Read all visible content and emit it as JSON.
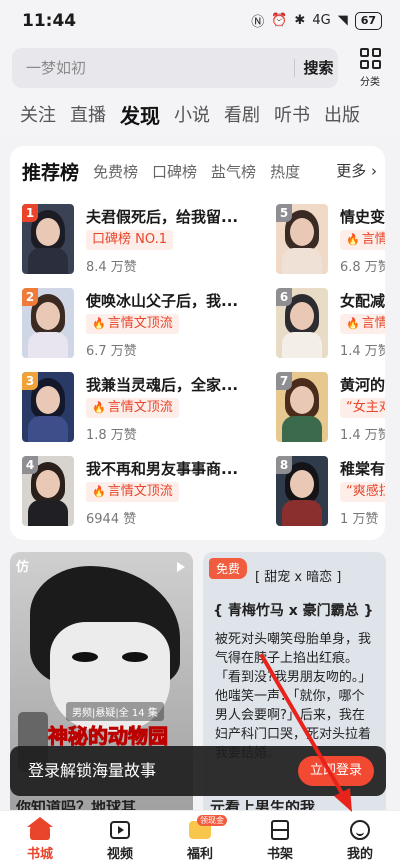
{
  "status": {
    "time": "11:44",
    "battery": "67",
    "signal": "4G"
  },
  "search": {
    "placeholder": "一梦如初",
    "button": "搜索",
    "category_label": "分类"
  },
  "tabs": [
    "关注",
    "直播",
    "发现",
    "小说",
    "看剧",
    "听书",
    "出版"
  ],
  "active_tab": "发现",
  "ranking": {
    "title": "推荐榜",
    "tabs": [
      "免费榜",
      "口碑榜",
      "盐气榜",
      "热度"
    ],
    "more": "更多",
    "books": [
      {
        "rank": "1",
        "title": "夫君假死后，给我留...",
        "tag": "口碑榜 NO.1",
        "likes": "8.4 万赞"
      },
      {
        "rank": "2",
        "title": "使唤冰山父子后，我...",
        "tag": "言情文顶流",
        "likes": "6.7 万赞"
      },
      {
        "rank": "3",
        "title": "我兼当灵魂后，全家...",
        "tag": "言情文顶流",
        "likes": "1.8 万赞"
      },
      {
        "rank": "4",
        "title": "我不再和男友事事商...",
        "tag": "言情文顶流",
        "likes": "6944 赞"
      },
      {
        "rank": "5",
        "title": "情史变蹊",
        "tag": "言情",
        "likes": "6.8 万赞"
      },
      {
        "rank": "6",
        "title": "女配减肥",
        "tag": "言情",
        "likes": "1.4 万赞"
      },
      {
        "rank": "7",
        "title": "黄河的女",
        "tag": "“女主对",
        "likes": "1.4 万赞"
      },
      {
        "rank": "8",
        "title": "稚棠有主",
        "tag": "“爽感拉",
        "likes": "1 万赞"
      }
    ]
  },
  "feed": {
    "left": {
      "badge": "仿",
      "meta": "男频|悬疑|全 14 集",
      "title": "神秘的动物园"
    },
    "right": {
      "badge": "免费",
      "tags_line1": "[ 甜宠 x 暗恋 ]",
      "tags_line2": "{ 青梅竹马 x 豪门霸总 }",
      "body": "被死对头嘲笑母胎单身，我气得在脖子上掐出红痕。「看到没?我男朋友吻的。」他嗤笑一声：「就你，哪个男人会要啊?」后来，我在妇产科门口哭，死对头拉着我要结婚。"
    }
  },
  "login_banner": {
    "text": "登录解锁海量故事",
    "button": "立即登录"
  },
  "peek": {
    "left": "你知道吗？地球其",
    "right": "元看上男生的我"
  },
  "nav": [
    {
      "label": "书城",
      "icon": "home-icon"
    },
    {
      "label": "视频",
      "icon": "video-icon"
    },
    {
      "label": "福利",
      "icon": "gift-icon",
      "badge": "领现金"
    },
    {
      "label": "书架",
      "icon": "bookshelf-icon"
    },
    {
      "label": "我的",
      "icon": "profile-icon"
    }
  ],
  "colors": {
    "accent": "#e8452b",
    "rank1": "#e8452b",
    "rank2": "#f07a3a",
    "rank3": "#f0a33a",
    "rank_other": "#8e8e93"
  }
}
